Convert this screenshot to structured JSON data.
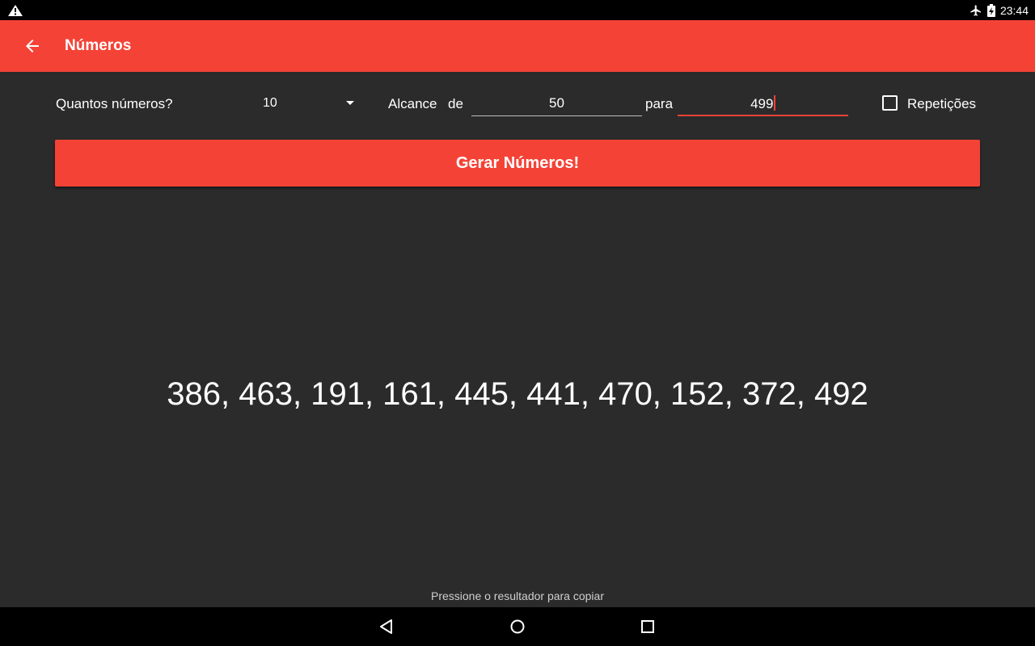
{
  "status_bar": {
    "time": "23:44",
    "icons": [
      "warning-icon",
      "airplane-mode-icon",
      "battery-charging-icon"
    ]
  },
  "app_bar": {
    "title": "Números",
    "back_icon": "arrow-back-icon"
  },
  "controls": {
    "count_label": "Quantos números?",
    "count_value": "10",
    "range_label": "Alcance",
    "from_label": "de",
    "from_value": "50",
    "to_label": "para",
    "to_value": "499",
    "repetitions_label": "Repetições",
    "repetitions_checked": false
  },
  "generate_button": {
    "label": "Gerar Números!"
  },
  "result": {
    "text": "386, 463, 191, 161, 445, 441, 470, 152, 372, 492"
  },
  "hint": {
    "text": "Pressione o resultador para copiar"
  },
  "nav_bar": {
    "icons": [
      "back-triangle-icon",
      "home-circle-icon",
      "recents-square-icon"
    ]
  },
  "colors": {
    "accent": "#f44336",
    "background": "#2b2b2b",
    "bars": "#000000"
  }
}
